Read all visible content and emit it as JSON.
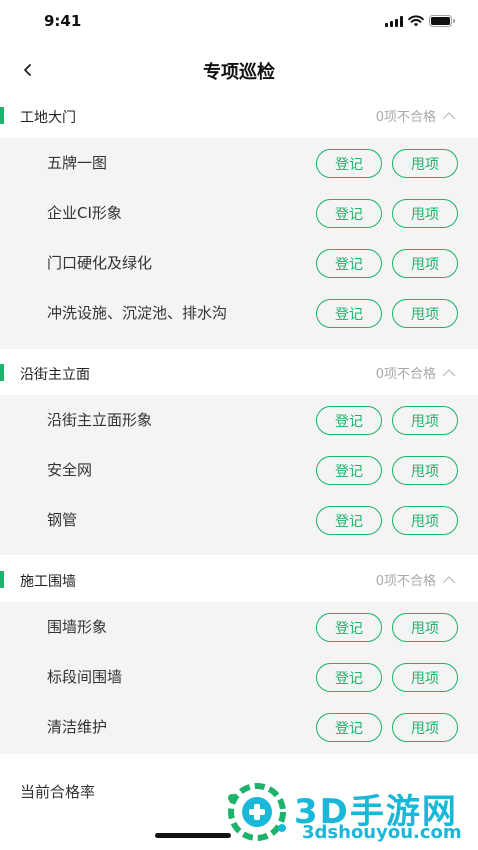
{
  "status_bar": {
    "time": "9:41"
  },
  "nav": {
    "title": "专项巡检"
  },
  "actions": {
    "register": "登记",
    "top": "甩项"
  },
  "sections": [
    {
      "title": "工地大门",
      "status": "0项不合格",
      "items": [
        "五牌一图",
        "企业CI形象",
        "门口硬化及绿化",
        "冲洗设施、沉淀池、排水沟"
      ]
    },
    {
      "title": "沿街主立面",
      "status": "0项不合格",
      "items": [
        "沿街主立面形象",
        "安全网",
        "钢管"
      ]
    },
    {
      "title": "施工围墙",
      "status": "0项不合格",
      "items": [
        "围墙形象",
        "标段间围墙",
        "清洁维护"
      ]
    }
  ],
  "footer": {
    "pass_rate_label": "当前合格率"
  },
  "watermark": {
    "main": "3D手游网",
    "sub": "3dshouyou.com"
  },
  "colors": {
    "accent": "#1db36a",
    "group_bg": "#f4f4f4",
    "muted": "#a9a9a9",
    "watermark": "#19b7d8"
  }
}
